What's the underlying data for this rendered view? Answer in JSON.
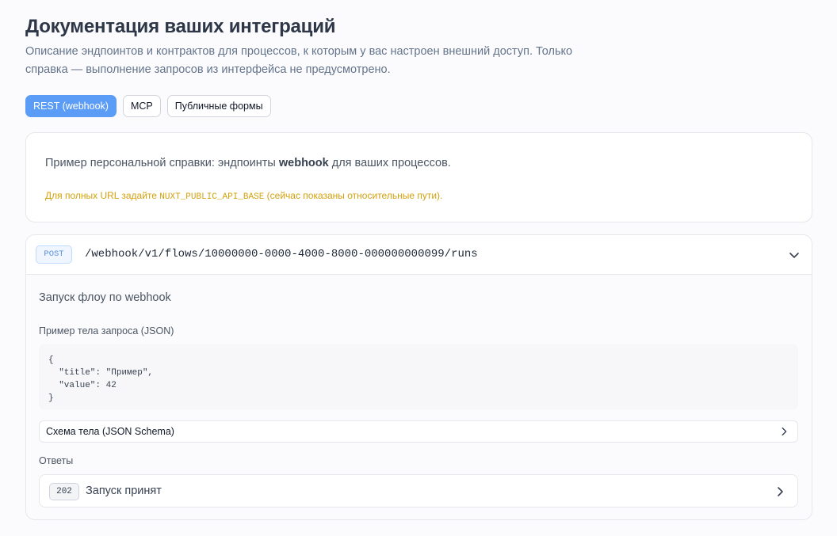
{
  "header": {
    "title": "Документация ваших интеграций",
    "subtitle": "Описание эндпоинтов и контрактов для процессов, к которым у вас настроен внешний доступ. Только справка — выполнение запросов из интерфейса не предусмотрено."
  },
  "tabs": [
    {
      "label": "REST (webhook)",
      "active": true
    },
    {
      "label": "MCP",
      "active": false
    },
    {
      "label": "Публичные формы",
      "active": false
    }
  ],
  "info": {
    "text_before": "Пример персональной справки: эндпоинты ",
    "text_bold": "webhook",
    "text_after": " для ваших процессов.",
    "note_before": "Для полных URL задайте ",
    "note_code": "NUXT_PUBLIC_API_BASE",
    "note_after": " (сейчас показаны относительные пути)."
  },
  "endpoint": {
    "method": "POST",
    "path": "/webhook/v1/flows/10000000-0000-4000-8000-000000000099/runs",
    "summary": "Запуск флоу по webhook",
    "request_label": "Пример тела запроса (JSON)",
    "request_example": "{\n  \"title\": \"Пример\",\n  \"value\": 42\n}",
    "schema_label": "Схема тела (JSON Schema)",
    "responses_label": "Ответы",
    "responses": [
      {
        "code": "202",
        "description": "Запуск принят"
      }
    ]
  },
  "icons": {
    "collapse": "chevron-down-icon",
    "expand": "chevron-right-icon"
  },
  "colors": {
    "accent": "#5b9cf6",
    "warning_text": "#d4a10c"
  }
}
